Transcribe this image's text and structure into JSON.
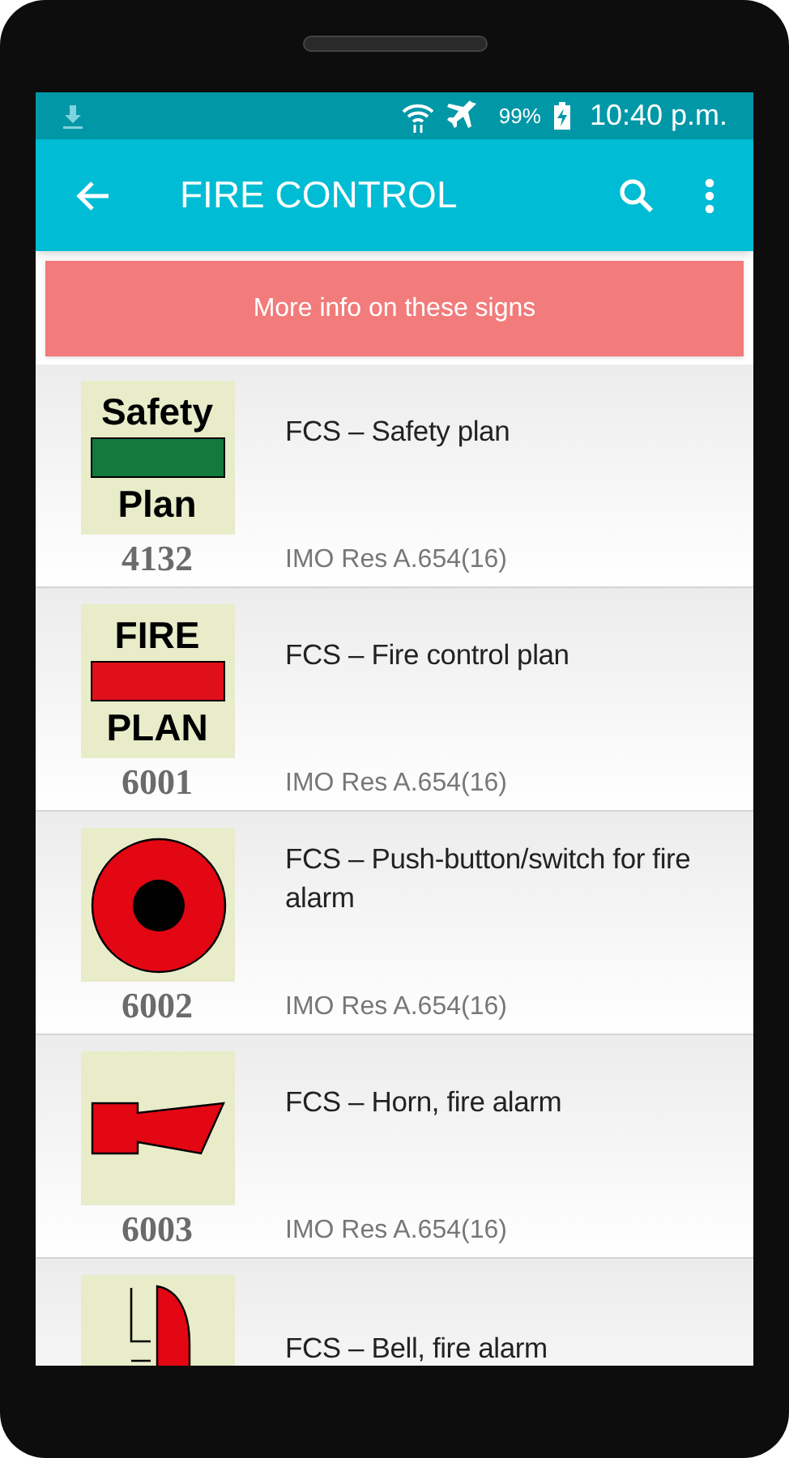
{
  "status_bar": {
    "battery": "99%",
    "time": "10:40 p.m."
  },
  "app_bar": {
    "title": "FIRE CONTROL"
  },
  "banner": {
    "label": "More info on these signs"
  },
  "signs": [
    {
      "sign": {
        "kind": "text_plan",
        "top": "Safety",
        "bottom": "Plan",
        "color": "#137a3e"
      },
      "number": "4132",
      "title": "FCS – Safety plan",
      "reference": "IMO Res A.654(16)"
    },
    {
      "sign": {
        "kind": "text_plan",
        "top": "FIRE",
        "bottom": "PLAN",
        "color": "#e0101a"
      },
      "number": "6001",
      "title": "FCS – Fire control plan",
      "reference": "IMO Res A.654(16)"
    },
    {
      "sign": {
        "kind": "push_button"
      },
      "number": "6002",
      "title": "FCS – Push-button/switch for fire alarm",
      "reference": "IMO Res A.654(16)"
    },
    {
      "sign": {
        "kind": "horn"
      },
      "number": "6003",
      "title": "FCS – Horn, fire alarm",
      "reference": "IMO Res A.654(16)"
    },
    {
      "sign": {
        "kind": "bell"
      },
      "title": "FCS – Bell, fire alarm"
    }
  ]
}
